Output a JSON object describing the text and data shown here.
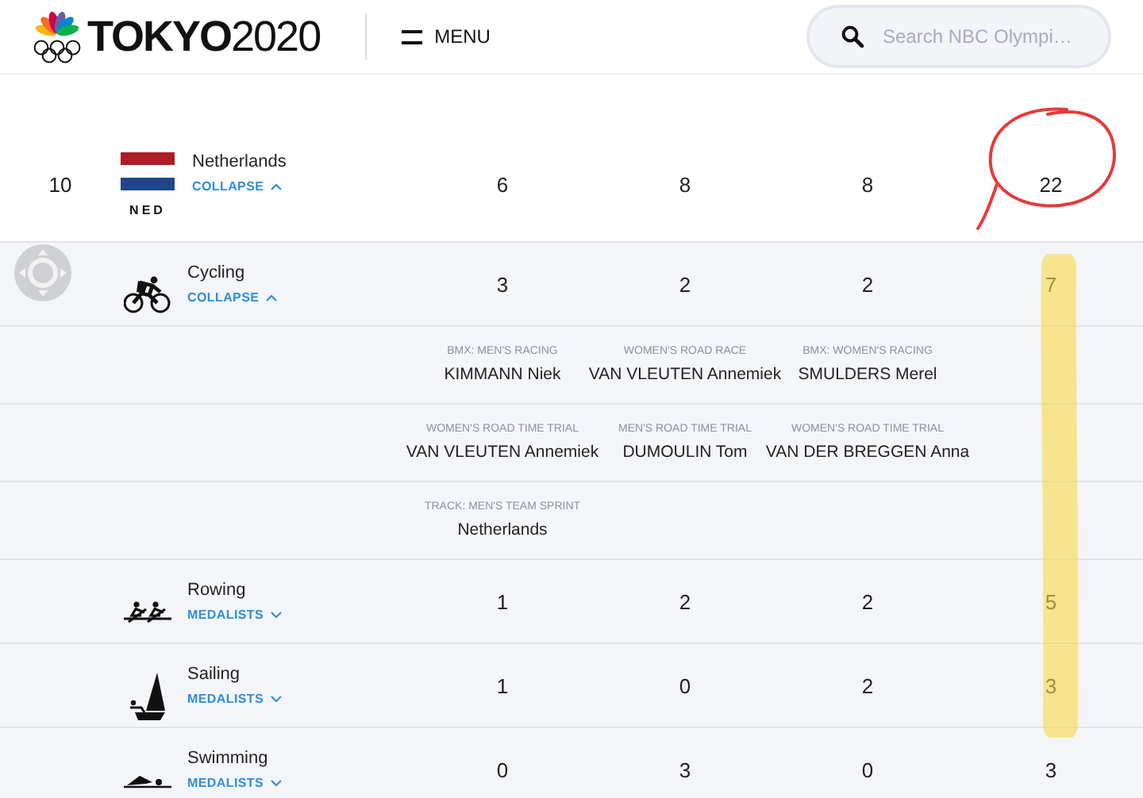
{
  "header": {
    "logo": {
      "bold": "TOKYO",
      "light": "2020"
    },
    "menu": {
      "label": "MENU"
    },
    "search": {
      "placeholder": "Search NBC Olympi…"
    }
  },
  "country": {
    "rank": "10",
    "name": "Netherlands",
    "code": "NED",
    "toggle": "COLLAPSE",
    "expanded": true,
    "gold": "6",
    "silver": "8",
    "bronze": "8",
    "total": "22"
  },
  "sports": [
    {
      "name": "Cycling",
      "toggle": "COLLAPSE",
      "expanded": true,
      "gold": "3",
      "silver": "2",
      "bronze": "2",
      "total": "7",
      "medalist_rows": [
        {
          "cells": [
            {
              "event": "BMX: MEN'S RACING",
              "athlete": "KIMMANN Niek"
            },
            {
              "event": "WOMEN'S ROAD RACE",
              "athlete": "VAN VLEUTEN Annemiek"
            },
            {
              "event": "BMX: WOMEN'S RACING",
              "athlete": "SMULDERS Merel"
            }
          ]
        },
        {
          "cells": [
            {
              "event": "WOMEN'S ROAD TIME TRIAL",
              "athlete": "VAN VLEUTEN Annemiek"
            },
            {
              "event": "MEN'S ROAD TIME TRIAL",
              "athlete": "DUMOULIN Tom"
            },
            {
              "event": "WOMEN'S ROAD TIME TRIAL",
              "athlete": "VAN DER BREGGEN Anna"
            }
          ]
        },
        {
          "cells": [
            {
              "event": "TRACK: MEN'S TEAM SPRINT",
              "athlete": "Netherlands"
            }
          ]
        }
      ]
    },
    {
      "name": "Rowing",
      "toggle": "MEDALISTS",
      "expanded": false,
      "gold": "1",
      "silver": "2",
      "bronze": "2",
      "total": "5"
    },
    {
      "name": "Sailing",
      "toggle": "MEDALISTS",
      "expanded": false,
      "gold": "1",
      "silver": "0",
      "bronze": "2",
      "total": "3"
    },
    {
      "name": "Swimming",
      "toggle": "MEDALISTS",
      "expanded": false,
      "gold": "0",
      "silver": "3",
      "bronze": "0",
      "total": "3"
    }
  ]
}
